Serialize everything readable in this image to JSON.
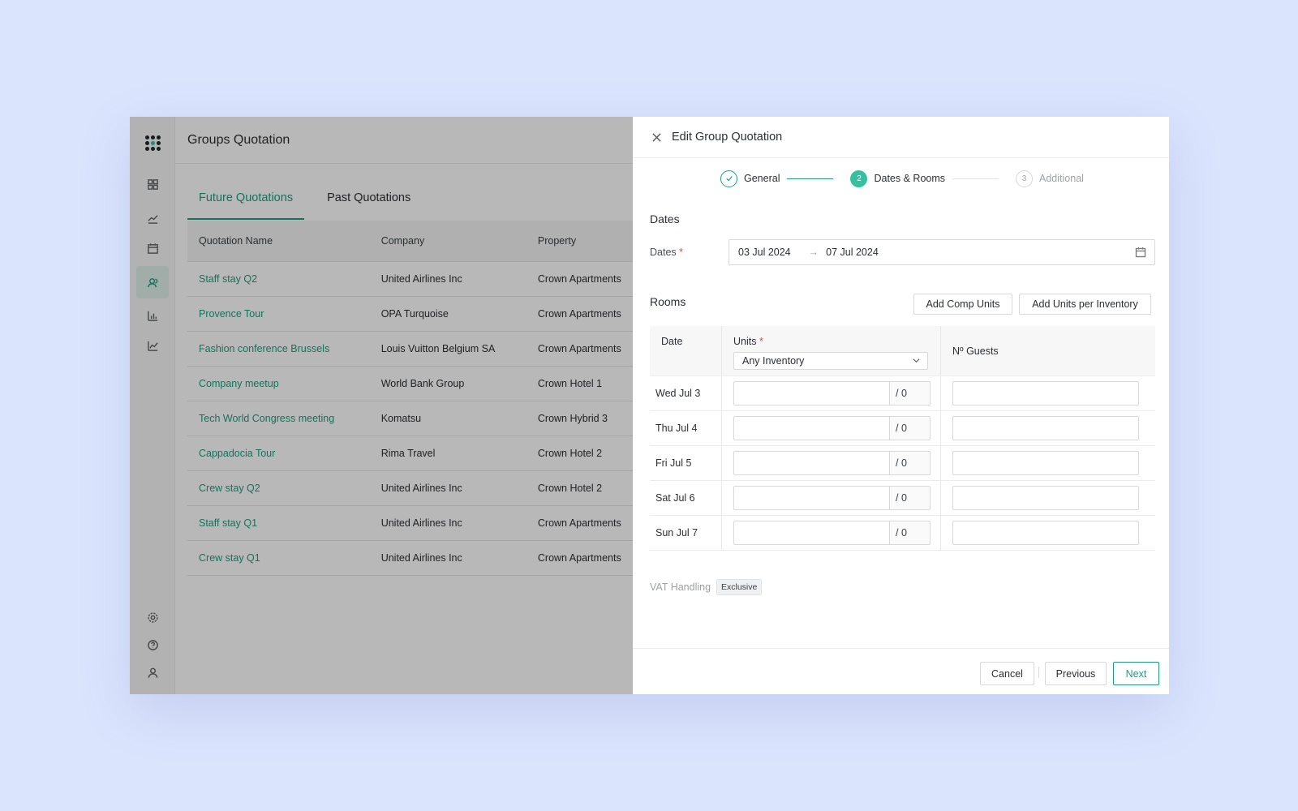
{
  "app": {
    "title": "Groups Quotation",
    "sidebar": {
      "top_icons": [
        "dashboard-icon",
        "trend-icon",
        "calendar-icon",
        "groups-icon",
        "bar-chart-icon",
        "line-chart-icon"
      ],
      "active": "groups-icon",
      "bottom_icons": [
        "settings-icon",
        "help-icon",
        "user-icon"
      ]
    }
  },
  "tabs": [
    {
      "label": "Future Quotations",
      "active": true
    },
    {
      "label": "Past Quotations",
      "active": false
    }
  ],
  "table": {
    "headers": [
      "Quotation Name",
      "Company",
      "Property"
    ],
    "rows": [
      [
        "Staff stay Q2",
        "United Airlines Inc",
        "Crown Apartments"
      ],
      [
        "Provence Tour",
        "OPA Turquoise",
        "Crown Apartments"
      ],
      [
        "Fashion conference Brussels",
        "Louis Vuitton Belgium SA",
        "Crown Apartments"
      ],
      [
        "Company meetup",
        "World Bank Group",
        "Crown Hotel 1"
      ],
      [
        "Tech World Congress meeting",
        "Komatsu",
        "Crown Hybrid 3"
      ],
      [
        "Cappadocia Tour",
        "Rima Travel",
        "Crown Hotel 2"
      ],
      [
        "Crew stay Q2",
        "United Airlines Inc",
        "Crown Hotel 2"
      ],
      [
        "Staff stay Q1",
        "United Airlines Inc",
        "Crown Apartments"
      ],
      [
        "Crew stay Q1",
        "United Airlines Inc",
        "Crown Apartments"
      ]
    ]
  },
  "drawer": {
    "title": "Edit Group Quotation",
    "steps": [
      {
        "number": "1",
        "label": "General",
        "state": "done"
      },
      {
        "number": "2",
        "label": "Dates & Rooms",
        "state": "current"
      },
      {
        "number": "3",
        "label": "Additional",
        "state": "todo"
      }
    ],
    "dates_section": "Dates",
    "dates_label": "Dates",
    "required_mark": "*",
    "date_from": "03 Jul 2024",
    "date_arrow": "→",
    "date_to": "07 Jul 2024",
    "rooms_section": "Rooms",
    "add_comp_units": "Add Comp Units",
    "add_units_per_inventory": "Add Units per Inventory",
    "rooms_table": {
      "col_date": "Date",
      "col_units": "Units",
      "col_guests": "Nº Guests",
      "inventory_selected": "Any Inventory",
      "rows": [
        {
          "date": "Wed Jul 3",
          "units": "",
          "suffix": "/ 0",
          "guests": ""
        },
        {
          "date": "Thu Jul 4",
          "units": "",
          "suffix": "/ 0",
          "guests": ""
        },
        {
          "date": "Fri Jul 5",
          "units": "",
          "suffix": "/ 0",
          "guests": ""
        },
        {
          "date": "Sat Jul 6",
          "units": "",
          "suffix": "/ 0",
          "guests": ""
        },
        {
          "date": "Sun Jul 7",
          "units": "",
          "suffix": "/ 0",
          "guests": ""
        }
      ]
    },
    "vat_label": "VAT Handling",
    "vat_value": "Exclusive",
    "buttons": {
      "cancel": "Cancel",
      "previous": "Previous",
      "next": "Next"
    }
  },
  "colors": {
    "accent": "#1f9e7d",
    "accent_fill": "#35c1a0",
    "background": "#dbe4fd",
    "required": "#e34b4b"
  }
}
